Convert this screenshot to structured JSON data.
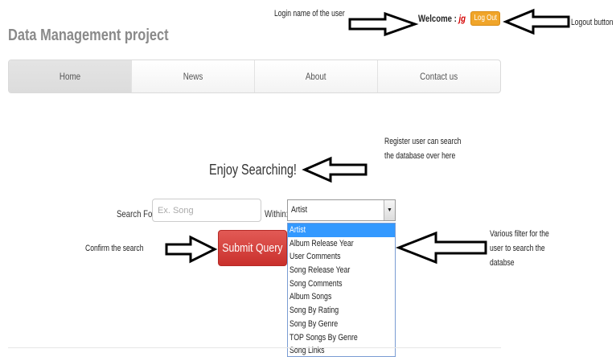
{
  "header": {
    "site_title": "Data Management project",
    "welcome_label": "Welcome :",
    "username": "jg",
    "logout_label": "Log Out"
  },
  "nav": {
    "items": [
      {
        "label": "Home",
        "active": true
      },
      {
        "label": "News"
      },
      {
        "label": "About"
      },
      {
        "label": "Contact us"
      }
    ]
  },
  "search": {
    "heading": "Enjoy Searching!",
    "search_for_label": "Search For:",
    "input_placeholder": "Ex. Song",
    "within_label": "Within:",
    "selected_value": "Artist",
    "options": [
      "Artist",
      "Album Release Year",
      "User Comments",
      "Song Release Year",
      "Song Comments",
      "Album Songs",
      "Song By Rating",
      "Song By Genre",
      "TOP Songs By Genre",
      "Song Links"
    ],
    "submit_label": "Submit Query"
  },
  "annotations": {
    "login_name": "Login name of the user",
    "logout_button": "Logout button",
    "search_line1": "Register user can search",
    "search_line2": "the database over here",
    "confirm": "Confirm the search",
    "filter_line1": "Various filter for the",
    "filter_line2": "user to search the",
    "filter_line3": "databse"
  },
  "colors": {
    "logout_bg": "#f0a52a",
    "submit_bg": "#d9534f",
    "username": "#d40000",
    "selected_option": "#3399ff"
  }
}
